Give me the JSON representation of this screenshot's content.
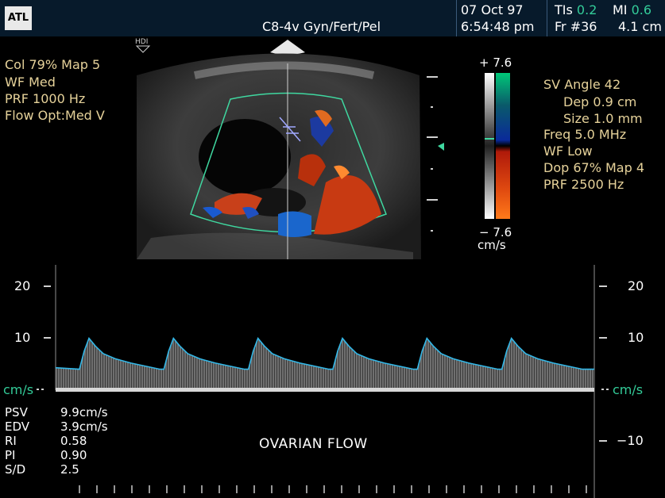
{
  "header": {
    "logo": "ATL",
    "probe": "C8-4v Gyn/Fert/Pel",
    "date": "07 Oct 97",
    "time": "6:54:48 pm",
    "tis_label": "TIs",
    "tis_value": "0.2",
    "mi_label": "MI",
    "mi_value": "0.6",
    "frame": "Fr #36",
    "depth": "4.1 cm"
  },
  "hdi_label": "HDI",
  "left_settings": [
    "Col 79%  Map 5",
    "WF Med",
    "PRF 1000  Hz",
    "Flow Opt:Med V"
  ],
  "right_settings": {
    "sv_angle": "SV Angle 42",
    "dep": "Dep 0.9  cm",
    "size": "Size 1.0  mm",
    "freq": "Freq 5.0  MHz",
    "wf": "WF Low",
    "dop": "Dop 67%  Map 4",
    "prf": "PRF 2500  Hz"
  },
  "color_bar": {
    "top": "+ 7.6",
    "bottom": "− 7.6",
    "unit": "cm/s",
    "colors": [
      "#00c878",
      "#0a2a9a",
      "#b01a0a",
      "#ff7a1a"
    ]
  },
  "doppler": {
    "left_scale": [
      "20",
      "10"
    ],
    "right_scale": [
      "20",
      "10",
      "−10"
    ],
    "unit_left": "cm/s",
    "unit_right": "cm/s",
    "label": "OVARIAN FLOW",
    "cycles": 6,
    "peak_velocity_cm_s": 9.9,
    "end_diastolic_velocity_cm_s": 3.9
  },
  "measurements": [
    {
      "label": "PSV",
      "value": "9.9cm/s"
    },
    {
      "label": "EDV",
      "value": "3.9cm/s"
    },
    {
      "label": "RI",
      "value": "0.58"
    },
    {
      "label": "PI",
      "value": "0.90"
    },
    {
      "label": "S/D",
      "value": "2.5"
    }
  ]
}
